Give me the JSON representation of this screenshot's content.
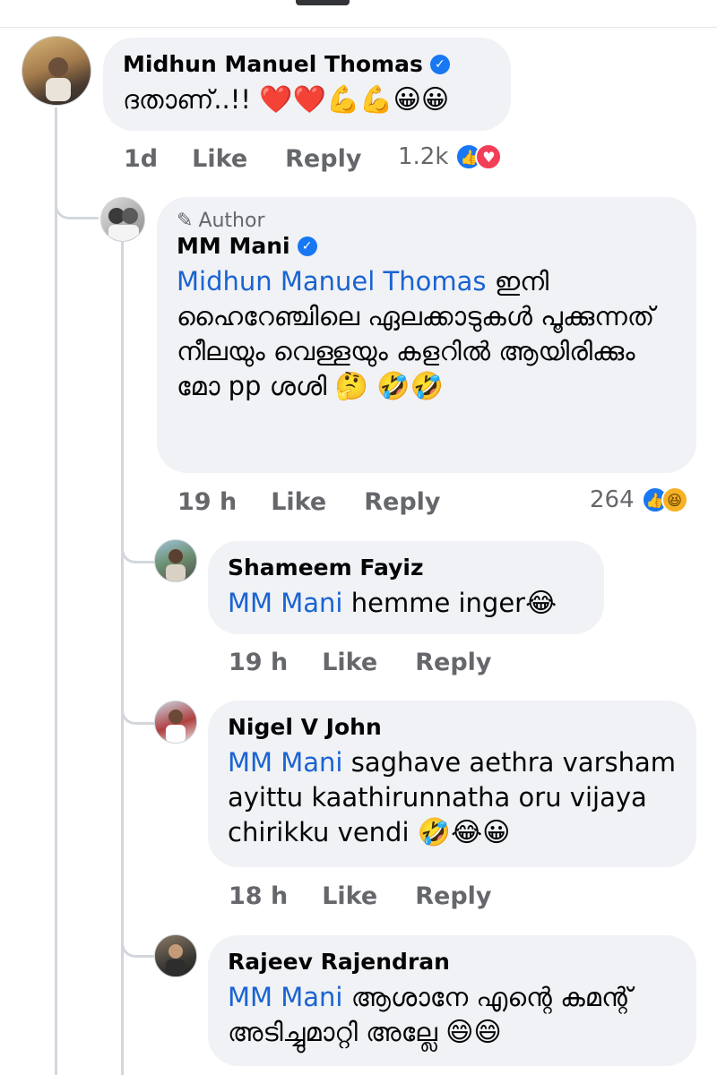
{
  "comments": [
    {
      "name": "Midhun Manuel Thomas",
      "verified": true,
      "text": "ദതാണ്..!!",
      "emojis": "❤️❤️💪💪😀😀",
      "time": "1d",
      "like": "Like",
      "reply": "Reply",
      "reaction_count": "1.2k",
      "reactions": [
        "like-icon",
        "love-icon"
      ]
    },
    {
      "author_tag": "Author",
      "name": "MM Mani",
      "verified": true,
      "mention": "Midhun Manuel Thomas",
      "text": "ഇനി ഹൈറേഞ്ചിലെ ഏലക്കാടുകൾ പൂക്കുന്നത് നീലയും വെള്ളയും കളറിൽ ആയിരിക്കും മോ pp ശശി",
      "emojis": "🤔",
      "emojis_line2": "🤣🤣",
      "time": "19 h",
      "like": "Like",
      "reply": "Reply",
      "reaction_count": "264",
      "reactions": [
        "like-icon",
        "haha-icon"
      ]
    },
    {
      "name": "Shameem Fayiz",
      "mention": "MM Mani",
      "text": "hemme inger",
      "emojis": "😂",
      "time": "19 h",
      "like": "Like",
      "reply": "Reply"
    },
    {
      "name": "Nigel V John",
      "mention": "MM Mani",
      "text": "saghave aethra varsham ayittu kaathirunnatha oru vijaya chirikku vendi",
      "emojis": "🤣😂😀",
      "time": "18 h",
      "like": "Like",
      "reply": "Reply"
    },
    {
      "name": "Rajeev Rajendran",
      "mention": "MM Mani",
      "text": "ആശാനേ എന്റെ കമന്റ് അടിച്ചുമാറ്റി അല്ലേ",
      "emojis": "😄😄"
    }
  ],
  "icons": {
    "verified": "verified-badge-icon",
    "pencil": "pencil-icon"
  },
  "colors": {
    "mention": "#1a63d1",
    "bubble": "#f0f2f5",
    "meta": "#65676b",
    "like_blue": "#1877f2",
    "love_red": "#f33e58"
  }
}
